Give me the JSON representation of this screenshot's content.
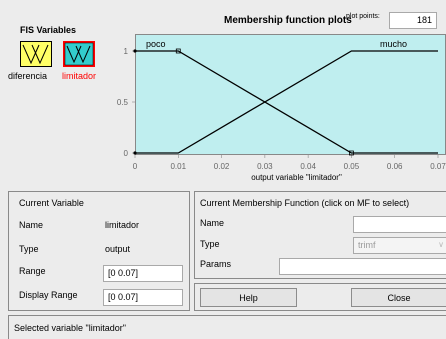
{
  "fis_variables": {
    "title": "FIS Variables",
    "inputs": [
      {
        "label": "diferencia",
        "color": "#ffff66"
      }
    ],
    "outputs": [
      {
        "label": "limitador",
        "color": "#33cccc",
        "selected_border": "#ff0000"
      }
    ]
  },
  "plot": {
    "title": "Membership function plots",
    "points_label": "plot points:",
    "points_value": "181",
    "xlabel": "output variable \"limitador\"",
    "background": "#bfeeef"
  },
  "chart_data": {
    "type": "line",
    "xlim": [
      0,
      0.07
    ],
    "ylim": [
      0,
      1
    ],
    "x_ticks": [
      "0",
      "0.01",
      "0.02",
      "0.03",
      "0.04",
      "0.05",
      "0.06",
      "0.07"
    ],
    "y_ticks": [
      "0",
      "0.5",
      "1"
    ],
    "series": [
      {
        "name": "poco",
        "x": [
          0,
          0.01,
          0.05,
          0.07
        ],
        "y": [
          1,
          1,
          0,
          0
        ],
        "color": "#000000"
      },
      {
        "name": "mucho",
        "x": [
          0,
          0.01,
          0.05,
          0.07
        ],
        "y": [
          0,
          0,
          1,
          1
        ],
        "color": "#000000"
      }
    ]
  },
  "current_variable": {
    "title": "Current Variable",
    "name_label": "Name",
    "name_value": "limitador",
    "type_label": "Type",
    "type_value": "output",
    "range_label": "Range",
    "range_value": "[0 0.07]",
    "display_range_label": "Display Range",
    "display_range_value": "[0 0.07]"
  },
  "current_mf": {
    "title": "Current Membership Function (click on MF to select)",
    "name_label": "Name",
    "name_value": "",
    "type_label": "Type",
    "type_value": "trimf",
    "params_label": "Params",
    "params_value": ""
  },
  "buttons": {
    "help": "Help",
    "close": "Close"
  },
  "status": "Selected variable \"limitador\""
}
